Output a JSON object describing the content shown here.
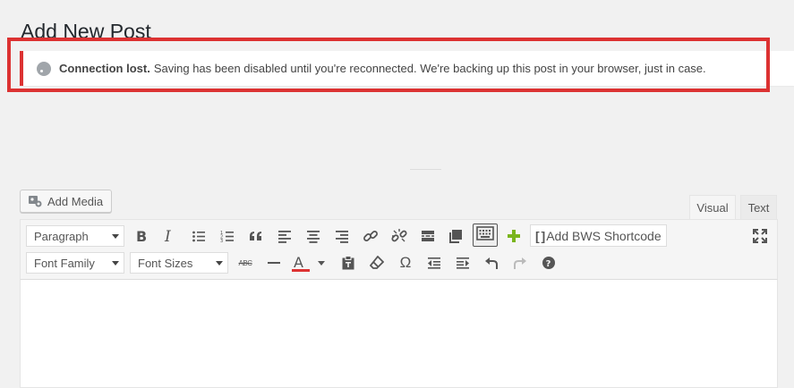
{
  "page": {
    "title": "Add New Post"
  },
  "notice": {
    "bold": "Connection lost.",
    "message": "Saving has been disabled until you're reconnected. We're backing up this post in your browser, just in case.",
    "highlight_color": "#dc3232"
  },
  "media": {
    "add_media_label": "Add Media"
  },
  "tabs": {
    "visual": "Visual",
    "text": "Text"
  },
  "toolbar": {
    "format_select": "Paragraph",
    "font_family_select": "Font Family",
    "font_sizes_select": "Font Sizes",
    "bws_shortcode_label": "Add BWS Shortcode",
    "strikethrough_glyph": "ABC",
    "text_color_accent": "#dd3333"
  },
  "icons": [
    "bold-icon",
    "italic-icon",
    "bulleted-list-icon",
    "numbered-list-icon",
    "blockquote-icon",
    "align-left-icon",
    "align-center-icon",
    "align-right-icon",
    "link-icon",
    "unlink-icon",
    "read-more-icon",
    "copy-icon",
    "keyboard-icon",
    "plus-icon",
    "fullscreen-icon",
    "strikethrough-icon",
    "horizontal-line-icon",
    "text-color-icon",
    "paste-text-icon",
    "clear-formatting-icon",
    "special-character-icon",
    "outdent-icon",
    "indent-icon",
    "undo-icon",
    "redo-icon",
    "help-icon"
  ]
}
